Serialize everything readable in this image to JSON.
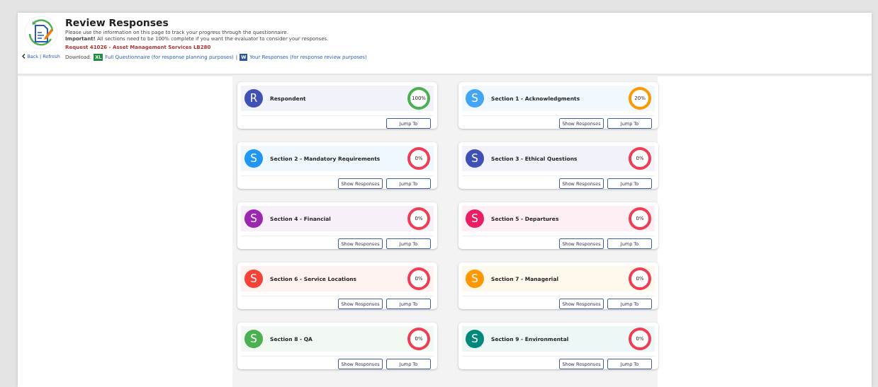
{
  "header": {
    "title": "Review Responses",
    "intro": "Please use the information on this page to track your progress through the questionnaire.",
    "important": "**Important!** All sections need to be 100% complete if you want the evaluator to consider your responses.",
    "request": "Request 41026 - Asset Management Services LB280",
    "back": "Back",
    "separator": "|",
    "refresh": "Refresh",
    "download_label": "Download:",
    "downloads": [
      {
        "kind": "excel",
        "badge": "XL",
        "label": "Full Questionnaire (for response planning purposes)"
      },
      {
        "kind": "word",
        "badge": "W",
        "label": "Your Responses (for response review purposes)"
      }
    ],
    "download_separator": "|"
  },
  "sections": [
    {
      "letter": "R",
      "title": "Respondent",
      "color": "#3f51b5",
      "progress": {
        "text": "100%",
        "color": "#4caf50"
      },
      "buttons": [
        "Jump To"
      ]
    },
    {
      "letter": "S",
      "title": "Section 1 - Acknowledgments",
      "color": "#42a5f5",
      "progress": {
        "text": "20%",
        "color": "#ff9800"
      },
      "buttons": [
        "Show Responses",
        "Jump To"
      ]
    },
    {
      "letter": "S",
      "title": "Section 2 - Mandatory Requirements",
      "color": "#2196f3",
      "progress": {
        "text": "0%",
        "color": "#ef3e54"
      },
      "buttons": [
        "Show Responses",
        "Jump To"
      ]
    },
    {
      "letter": "S",
      "title": "Section 3 - Ethical Questions",
      "color": "#3f51b5",
      "progress": {
        "text": "0%",
        "color": "#ef3e54"
      },
      "buttons": [
        "Show Responses",
        "Jump To"
      ]
    },
    {
      "letter": "S",
      "title": "Section 4 - Financial",
      "color": "#9c27b0",
      "progress": {
        "text": "0%",
        "color": "#ef3e54"
      },
      "buttons": [
        "Show Responses",
        "Jump To"
      ]
    },
    {
      "letter": "S",
      "title": "Section 5 - Departures",
      "color": "#e91e63",
      "progress": {
        "text": "0%",
        "color": "#ef3e54"
      },
      "buttons": [
        "Show Responses",
        "Jump To"
      ]
    },
    {
      "letter": "S",
      "title": "Section 6 - Service Locations",
      "color": "#f44336",
      "progress": {
        "text": "0%",
        "color": "#ef3e54"
      },
      "buttons": [
        "Show Responses",
        "Jump To"
      ]
    },
    {
      "letter": "S",
      "title": "Section 7 - Managerial",
      "color": "#ff9800",
      "progress": {
        "text": "0%",
        "color": "#ef3e54"
      },
      "buttons": [
        "Show Responses",
        "Jump To"
      ]
    },
    {
      "letter": "S",
      "title": "Section 8 - QA",
      "color": "#4caf50",
      "progress": {
        "text": "0%",
        "color": "#ef3e54"
      },
      "buttons": [
        "Show Responses",
        "Jump To"
      ]
    },
    {
      "letter": "S",
      "title": "Section 9 - Environmental",
      "color": "#00897b",
      "progress": {
        "text": "0%",
        "color": "#ef3e54"
      },
      "buttons": [
        "Show Responses",
        "Jump To"
      ]
    }
  ]
}
